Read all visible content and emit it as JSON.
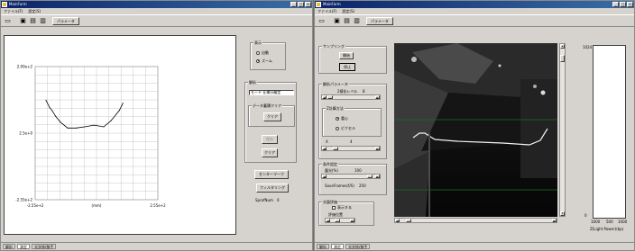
{
  "left_window": {
    "title": "MainForm",
    "menu": [
      "ファイル(F)",
      "設定(S)"
    ],
    "toolbar": {
      "icons": [
        "folder-icon",
        "save-icon",
        "print-icon",
        "copy-icon"
      ],
      "param_button": "パラメータ"
    },
    "display_group": {
      "title": "表示",
      "options": [
        "自動",
        "ズーム"
      ],
      "selected": 1
    },
    "analysis_group": {
      "title": "解析",
      "mode": "モード 仕様分離定",
      "data_clear_title": "データ蓄積クリア",
      "clear_button": "クリア",
      "disabled_button": "保存",
      "clear_button2": "クリア"
    },
    "center_mark_button": "センターマーク",
    "filtering_button": "フィルタリング",
    "sprof_label": "SprofNum",
    "sprof_value": "0",
    "status_tabs": [
      "解析",
      "測定",
      "光学係/移手"
    ]
  },
  "right_window": {
    "title": "MainForm",
    "menu": [
      "ファイル(F)",
      "設定(S)"
    ],
    "toolbar": {
      "icons": [
        "folder-icon",
        "save-icon",
        "print-icon",
        "copy-icon"
      ],
      "param_button": "パラメータ"
    },
    "sampling_group": {
      "title": "サンプリング",
      "start_button": "開始",
      "stop_button": "停止"
    },
    "params_group": {
      "title": "解析パラメータ",
      "threshold_label": "2値化レベル",
      "threshold_value": "8",
      "calc_title": "Z計算方法",
      "calc_options": [
        "重心",
        "ピクセル"
      ],
      "calc_selected": 0,
      "x_label": "X",
      "x_value": "4"
    },
    "conditions_group": {
      "title": "条件設定",
      "exposure_label": "露光(%)",
      "exposure_value": "100",
      "frames_label": "SaveFrames(f/S)",
      "frames_value": "250"
    },
    "evaluation_group": {
      "title": "光量評価",
      "show_label": "表示する",
      "position_label": "評価位置"
    },
    "power_panel": {
      "top_value": "1024",
      "bottom_value": "0",
      "scale_ticks": [
        "1000",
        "500",
        "1000"
      ],
      "label": "Z(Light Power)(bp)"
    },
    "status_tabs": [
      "解析",
      "測定",
      "光学係/移手"
    ]
  },
  "chart_data": {
    "type": "line",
    "title": "",
    "ylabel": "",
    "xlabel": "",
    "y_tick_labels": [
      "2.00e+2",
      "2.5e+0",
      "-2.55e+2"
    ],
    "x_tick_labels": [
      "-2.55e+2",
      "(mm)",
      "2.55e+2"
    ],
    "xlim": [
      -255,
      255
    ],
    "ylim": [
      -255,
      200
    ],
    "grid": true,
    "series": [
      {
        "x": [
          -210,
          -195,
          -185,
          -170,
          -150,
          -120,
          -85,
          -50,
          -10,
          30,
          60,
          95,
          110
        ],
        "y": [
          85,
          60,
          50,
          30,
          10,
          -10,
          -10,
          -6,
          0,
          -6,
          15,
          50,
          75
        ]
      }
    ]
  }
}
